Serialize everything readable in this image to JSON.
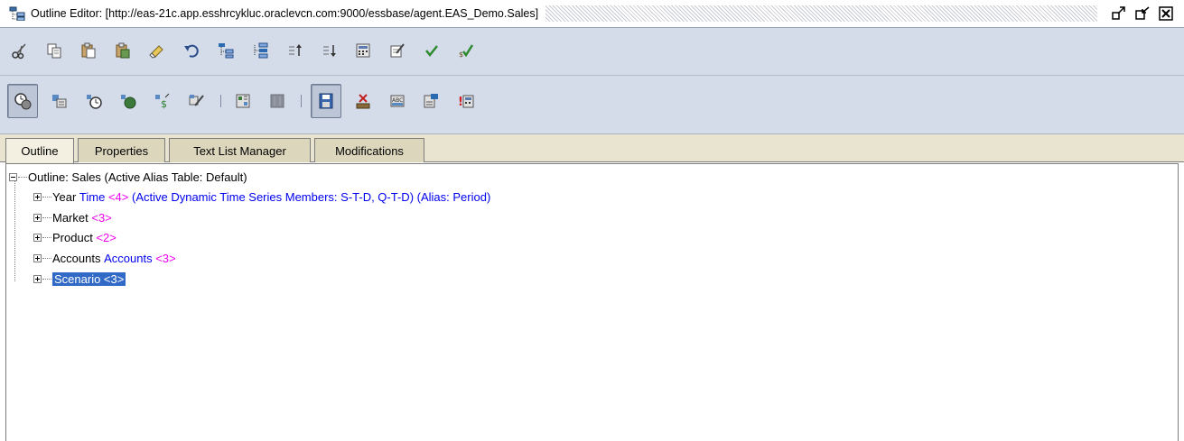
{
  "window": {
    "title": "Outline Editor: [http://eas-21c.app.esshrcykluc.oraclevcn.com:9000/essbase/agent.EAS_Demo.Sales]"
  },
  "toolbar1": [
    "cut-icon",
    "copy-icon",
    "paste-icon",
    "paste-special-icon",
    "clear-icon",
    "undo-icon",
    "add-child-icon",
    "add-sibling-icon",
    "sort-ascending-icon",
    "sort-descending-icon",
    "calculator-icon",
    "edit-properties-icon",
    "verify-check-icon",
    "verify-all-icon"
  ],
  "toolbar2": [
    "view-toggle-icon",
    "member-properties-icon",
    "time-icon",
    "dimension-icon",
    "formula-icon",
    "attributes-icon",
    "associate-icon",
    "disabled-icon",
    "save-icon",
    "delete-icon",
    "spelling-icon",
    "dimension-build-icon",
    "alert-calculator-icon"
  ],
  "tabs": [
    {
      "label": "Outline"
    },
    {
      "label": "Properties"
    },
    {
      "label": "Text List Manager"
    },
    {
      "label": "Modifications"
    }
  ],
  "outline": {
    "root": "Outline: Sales (Active Alias Table: Default)",
    "members": [
      {
        "name": "Year",
        "type": "Time",
        "count": "<4>",
        "info": "(Active Dynamic Time Series Members: S-T-D, Q-T-D) (Alias: Period)"
      },
      {
        "name": "Market",
        "count": "<3>"
      },
      {
        "name": "Product",
        "count": "<2>"
      },
      {
        "name": "Accounts",
        "type": "Accounts",
        "count": "<3>"
      },
      {
        "name": "Scenario <3>"
      }
    ]
  },
  "colors": {
    "member_type": "#0000ee",
    "member_count": "#ee00ee",
    "selection": "#3169c6"
  }
}
